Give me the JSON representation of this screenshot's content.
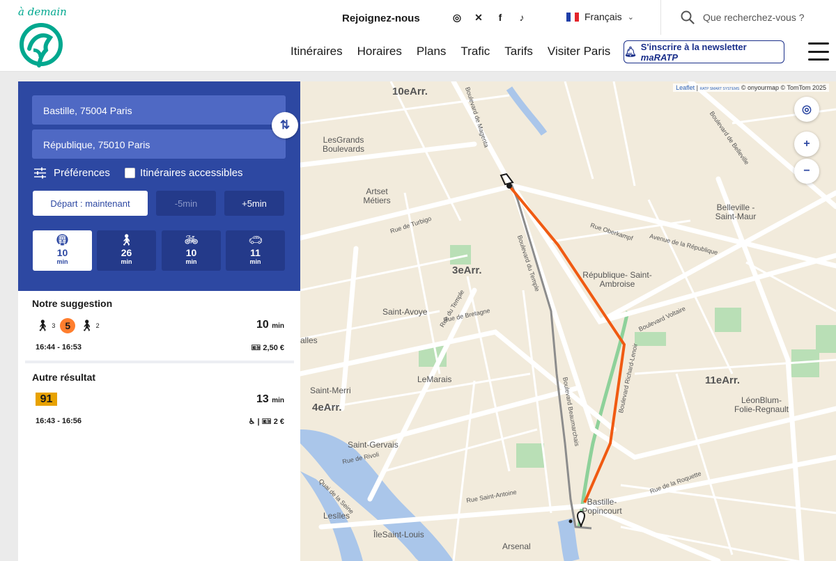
{
  "header": {
    "tagline": "à demain",
    "join": "Rejoignez-nous",
    "socials": [
      "instagram-icon",
      "x-icon",
      "facebook-icon",
      "tiktok-icon"
    ],
    "language": "Français",
    "search_placeholder": "Que recherchez-vous ?",
    "nav": [
      "Itinéraires",
      "Horaires",
      "Plans",
      "Trafic",
      "Tarifs",
      "Visiter Paris"
    ],
    "newsletter_prefix": "S'inscrire à la newsletter ",
    "newsletter_brand": "maRATP",
    "colors": {
      "brand": "#00a88f",
      "navy": "#1a2f8a"
    }
  },
  "form": {
    "from": "Bastille, 75004 Paris",
    "to": "République, 75010 Paris",
    "preferences": "Préférences",
    "accessible": "Itinéraires accessibles",
    "depart": "Départ : maintenant",
    "minus": "-5min",
    "plus": "+5min",
    "modes": [
      {
        "icon": "transit-icon",
        "value": "10",
        "unit": "min",
        "active": true
      },
      {
        "icon": "walk-icon",
        "value": "26",
        "unit": "min",
        "active": false
      },
      {
        "icon": "bike-icon",
        "value": "10",
        "unit": "min",
        "active": false
      },
      {
        "icon": "car-icon",
        "value": "11",
        "unit": "min",
        "active": false
      }
    ],
    "colors": {
      "panel": "#2d48a2",
      "field": "#4f69c4"
    }
  },
  "results": {
    "suggestion_title": "Notre suggestion",
    "suggestion": {
      "walk_before": "3",
      "line": "5",
      "walk_after": "2",
      "duration": "10",
      "duration_unit": "min",
      "times": "16:44 - 16:53",
      "price": "2,50 €",
      "line_color": "#ff7e2e"
    },
    "other_title": "Autre résultat",
    "other": {
      "line": "91",
      "duration": "13",
      "duration_unit": "min",
      "times": "16:43 - 16:56",
      "price": "2 €",
      "line_color": "#e8a200"
    }
  },
  "map": {
    "attribution_leaflet": "Leaflet",
    "attribution_rest": "© onyourmap © TomTom 2025",
    "smart_systems": "RATP SMART SYSTEMS",
    "controls": {
      "locate": "locate-icon",
      "zoom_in": "+",
      "zoom_out": "−"
    },
    "districts": [
      "10eArr.",
      "3eArr.",
      "11eArr.",
      "4eArr."
    ],
    "places": [
      "LesGrands Boulevards",
      "Artset Métiers",
      "République- Saint-Ambroise",
      "Belleville -Saint-Maur",
      "Saint-Avoye",
      "LeMarais",
      "Saint-Merri",
      "Saint-Gervais",
      "LéonBlum- Folie-Regnault",
      "Bastille- Popincourt",
      "Lesîles",
      "ÎleSaint-Louis",
      "Arsenal",
      "alles"
    ],
    "streets": [
      "Boulevard de Magenta",
      "Rue du Temple",
      "Boulevard Voltaire",
      "Avenue de la République",
      "Boulevard Beaumarchais",
      "Boulevard du Temple",
      "Rue de Bretagne",
      "Rue de Turbigo",
      "Rue Oberkampf",
      "Boulevard de Belleville",
      "Boulevard Richard-Lenoir",
      "Rue de la Roquette",
      "Rue Saint-Antoine",
      "Rue de Rivoli",
      "Quai de la Seine"
    ],
    "route_colors": {
      "walk_metro": "#f05a12",
      "bus": "#8c8c8c"
    }
  }
}
